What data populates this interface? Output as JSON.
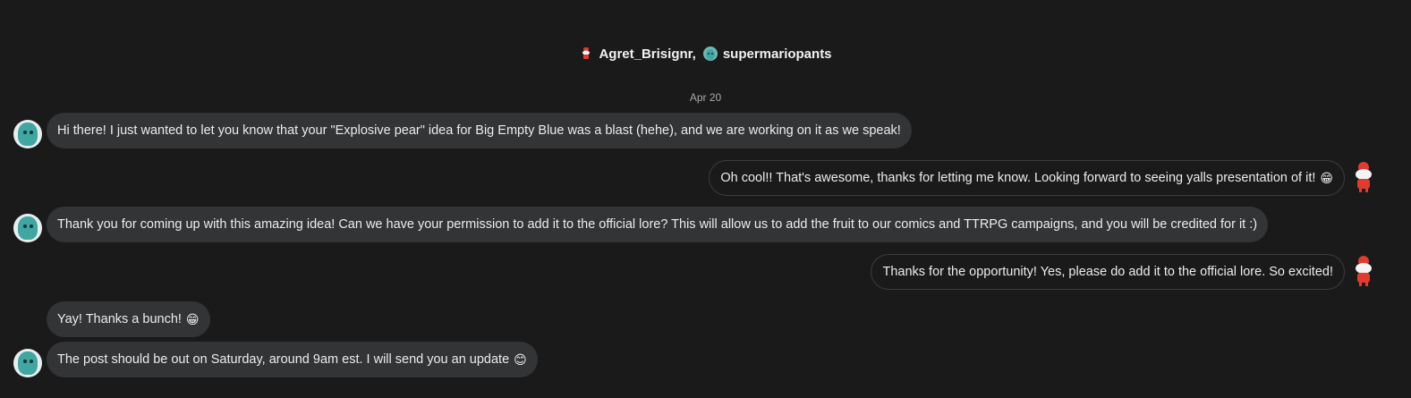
{
  "header": {
    "user1": "Agret_Brisignr,",
    "user2": "supermariopants"
  },
  "date": "Apr 20",
  "messages": [
    {
      "text": "Hi there! I just wanted to let you know that your \"Explosive pear\" idea for Big Empty Blue was a blast (hehe), and we are working on it as we speak!",
      "emoji": ""
    },
    {
      "text": "Oh cool!! That's awesome, thanks for letting me know. Looking forward to seeing yalls presentation of it!",
      "emoji": "😁"
    },
    {
      "text": "Thank you for coming up with this amazing idea! Can we have your permission to add it to the official lore? This will allow us to add the fruit to our comics and TTRPG campaigns, and you will be credited for it :)",
      "emoji": ""
    },
    {
      "text": "Thanks for the opportunity! Yes, please do add it to the official lore. So excited!",
      "emoji": ""
    },
    {
      "text": "Yay! Thanks a bunch!",
      "emoji": "😁"
    },
    {
      "text": "The post should be out on Saturday, around 9am est. I will send you an update",
      "emoji": "😊"
    }
  ],
  "icons": {
    "incoming_avatar": "avatar-icon",
    "outgoing_avatar": "avatar-icon"
  },
  "colors": {
    "background": "#1a1a1b",
    "incoming_bubble": "#333436",
    "outgoing_border": "#3c3c3e"
  }
}
